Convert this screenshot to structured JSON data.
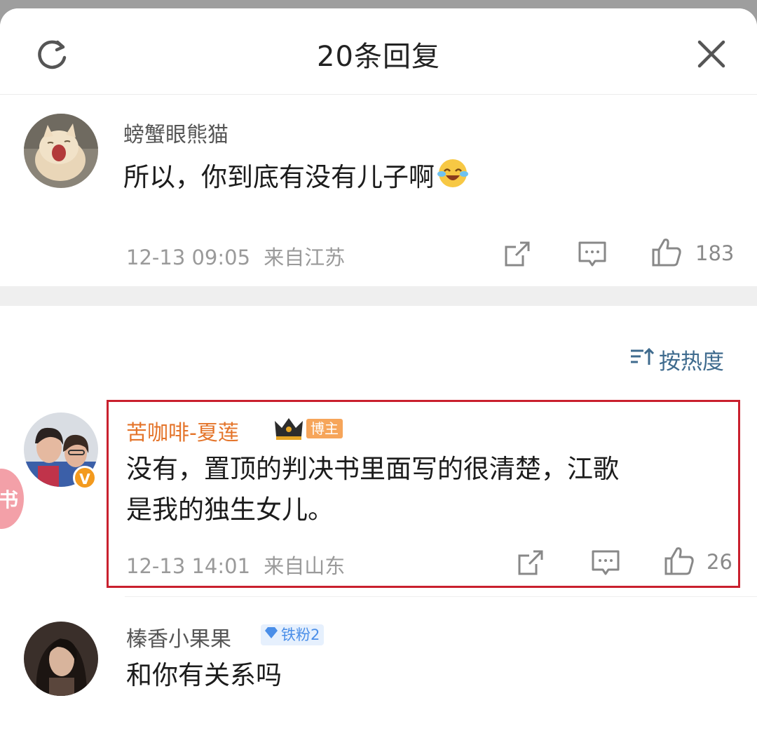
{
  "header": {
    "title": "20条回复",
    "refresh_icon": "refresh-icon",
    "close_icon": "close-icon"
  },
  "parent_comment": {
    "username": "螃蟹眼熊猫",
    "text": "所以，你到底有没有儿子啊",
    "emoji": "laughing-tears-emoji",
    "time": "12-13 09:05",
    "location": "来自江苏",
    "likes": "183"
  },
  "sort": {
    "label": "按热度",
    "icon": "sort-icon"
  },
  "replies": [
    {
      "username": "苦咖啡-夏莲",
      "badge": "博主",
      "verified": "V",
      "text_line1": "没有，置顶的判决书里面写的很清楚，江歌",
      "text_line2": "是我的独生女儿。",
      "time": "12-13 14:01",
      "location": "来自山东",
      "likes": "26"
    },
    {
      "username": "榛香小果果",
      "badge": "铁粉2",
      "text": "和你有关系吗"
    }
  ],
  "side_bubble": "书",
  "colors": {
    "highlight": "#c9202e",
    "username_author": "#e4742a",
    "link_blue": "#3f6b8e"
  }
}
